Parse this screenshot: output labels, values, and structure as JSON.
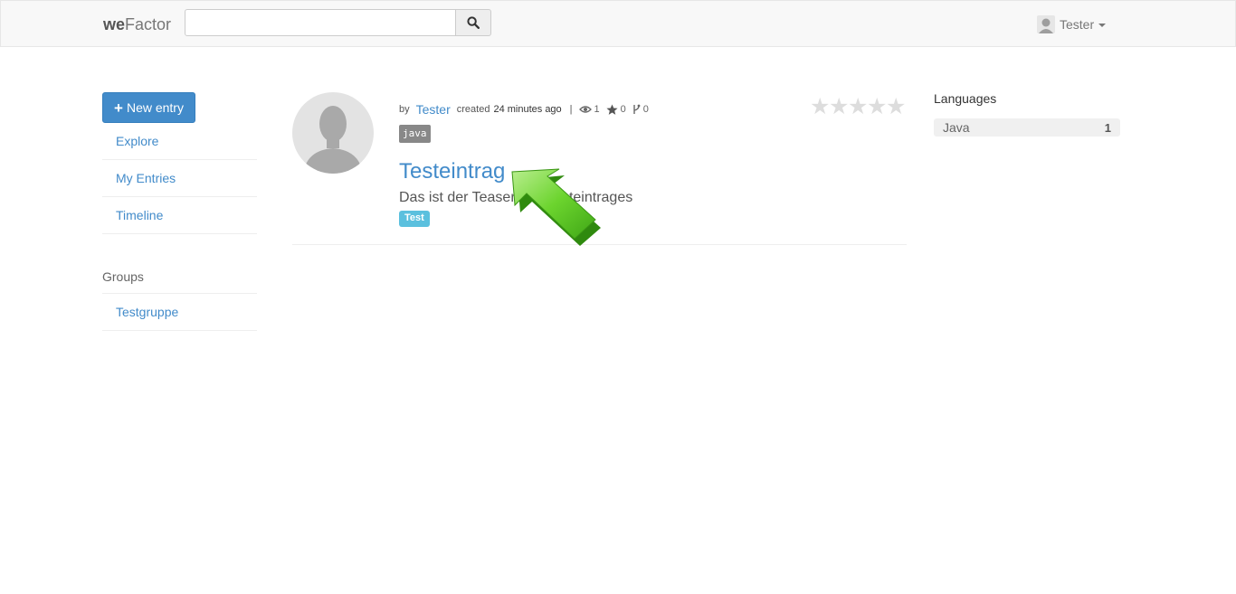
{
  "navbar": {
    "brand_bold": "we",
    "brand_rest": "Factor",
    "search_value": "",
    "user_name": "Tester"
  },
  "sidebar": {
    "new_entry_label": "New entry",
    "items": [
      {
        "label": "Explore"
      },
      {
        "label": "My Entries"
      },
      {
        "label": "Timeline"
      }
    ],
    "groups_heading": "Groups",
    "groups": [
      {
        "label": "Testgruppe"
      }
    ]
  },
  "entry": {
    "by_label": "by",
    "author": "Tester",
    "created_label": "created",
    "created_time": "24 minutes ago",
    "separator": "|",
    "views": "1",
    "stars": "0",
    "forks": "0",
    "language": "java",
    "title": "Testeintrag",
    "teaser": "Das ist der Teaser des Testeintrages",
    "tag": "Test",
    "rating": 0
  },
  "languages": {
    "heading": "Languages",
    "items": [
      {
        "name": "Java",
        "count": "1"
      }
    ]
  },
  "colors": {
    "primary": "#428bca",
    "info": "#5bc0de",
    "arrow": "#5fc521"
  }
}
